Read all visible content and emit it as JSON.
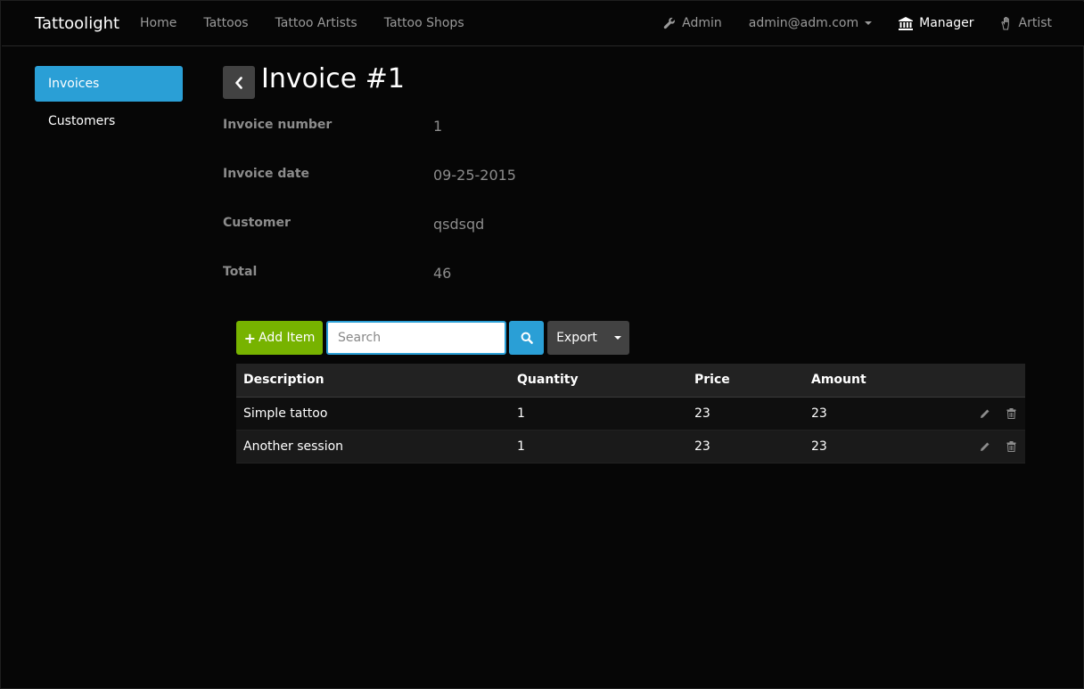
{
  "navbar": {
    "brand": "Tattoolight",
    "links": [
      "Home",
      "Tattoos",
      "Tattoo Artists",
      "Tattoo Shops"
    ],
    "admin_label": "Admin",
    "user_email": "admin@adm.com",
    "manager_label": "Manager",
    "artist_label": "Artist",
    "icons": {
      "admin": "wrench-icon",
      "manager": "bank-icon",
      "artist": "hand-icon"
    }
  },
  "sidebar": {
    "items": [
      {
        "label": "Invoices",
        "active": true
      },
      {
        "label": "Customers",
        "active": false
      }
    ]
  },
  "page": {
    "title": "Invoice #1",
    "fields": [
      {
        "label": "Invoice number",
        "value": "1"
      },
      {
        "label": "Invoice date",
        "value": "09-25-2015"
      },
      {
        "label": "Customer",
        "value": "qsdsqd"
      },
      {
        "label": "Total",
        "value": "46"
      }
    ]
  },
  "toolbar": {
    "add_label": "Add Item",
    "search_placeholder": "Search",
    "search_value": "",
    "export_label": "Export"
  },
  "table": {
    "headers": [
      "Description",
      "Quantity",
      "Price",
      "Amount"
    ],
    "rows": [
      {
        "description": "Simple tattoo",
        "quantity": "1",
        "price": "23",
        "amount": "23"
      },
      {
        "description": "Another session",
        "quantity": "1",
        "price": "23",
        "amount": "23"
      }
    ]
  },
  "colors": {
    "accent": "#2a9fd6",
    "success": "#77b300",
    "background": "#060606",
    "button_dark": "#424242"
  }
}
